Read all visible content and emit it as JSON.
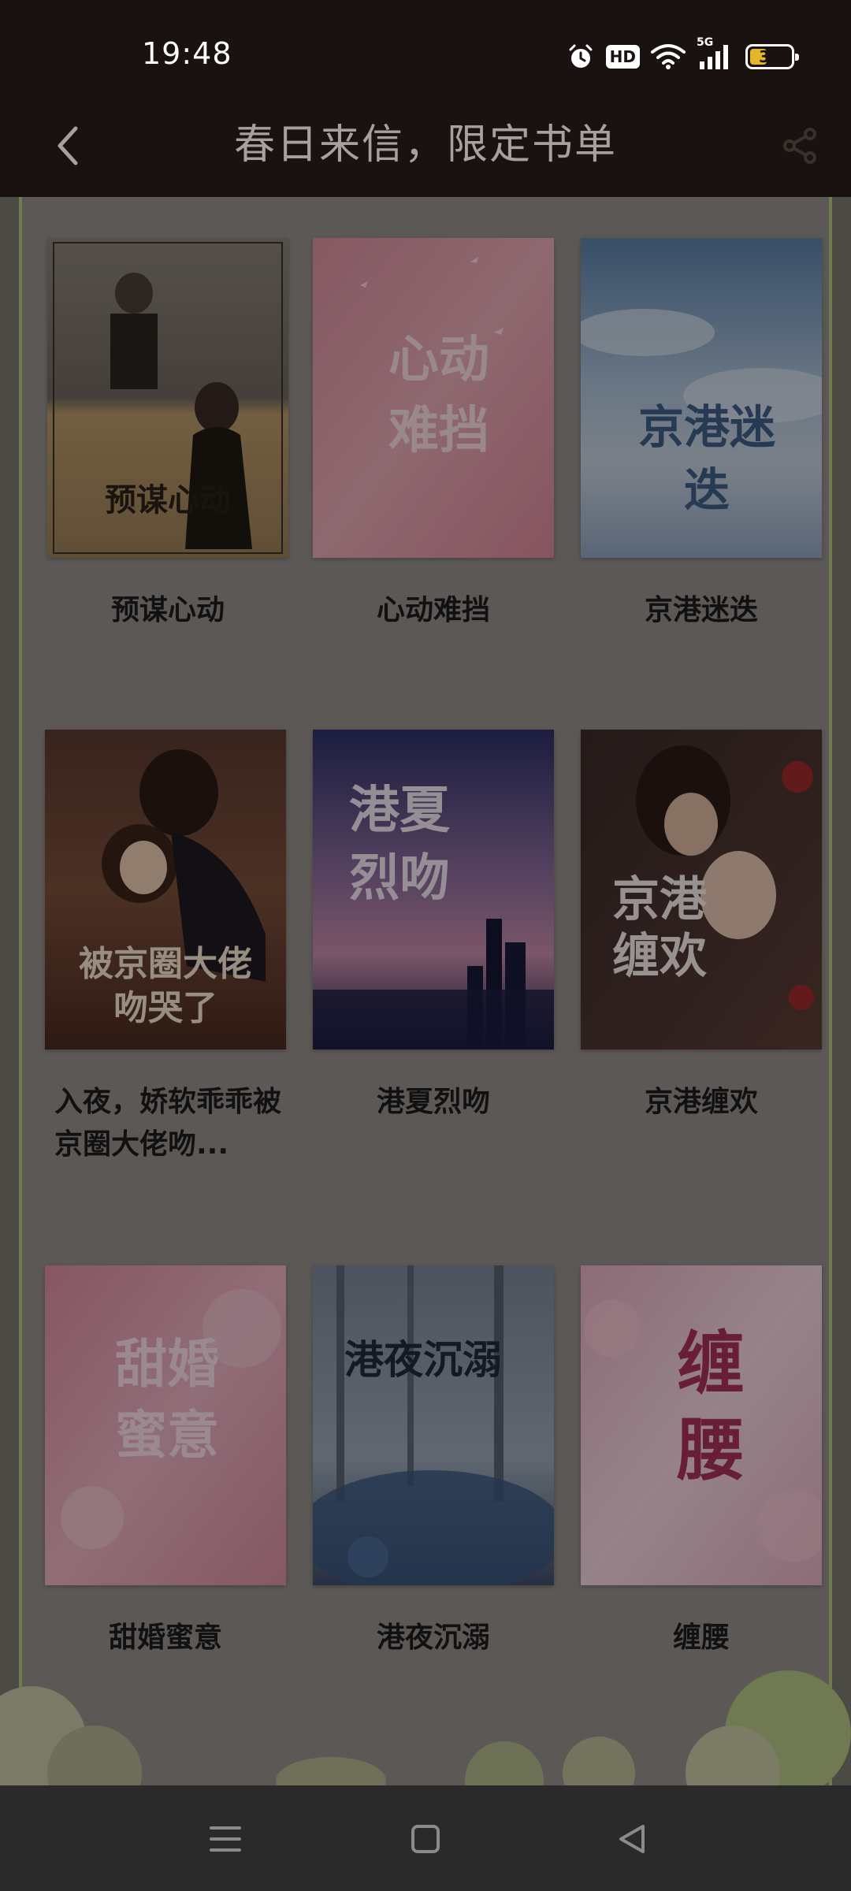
{
  "status_bar": {
    "time": "19:48",
    "icons": [
      "alarm-icon",
      "hd-icon",
      "wifi-icon",
      "5g-signal-icon",
      "battery-icon"
    ],
    "hd_label": "HD",
    "network_label": "5G",
    "battery_level": "39"
  },
  "header": {
    "title": "春日来信，限定书单",
    "back_icon": "chevron-left-icon",
    "share_icon": "share-icon"
  },
  "books": [
    {
      "title": "预谋心动",
      "cover_text": "预谋心动",
      "cover_colors": [
        "#8a8178",
        "#c9b28a"
      ],
      "cover_text_color": "#2a2016"
    },
    {
      "title": "心动难挡",
      "cover_text": "心动难挡",
      "cover_colors": [
        "#e9a7b4",
        "#d98b9a"
      ],
      "cover_text_color": "#f6dde2"
    },
    {
      "title": "京港迷迭",
      "cover_text": "京港迷迭",
      "cover_colors": [
        "#6d8fb2",
        "#b9c7d8"
      ],
      "cover_text_color": "#3e5d86"
    },
    {
      "title": "入夜，娇软乖乖被京圈大佬吻...",
      "cover_text": "被京圈大佬吻哭了",
      "cover_colors": [
        "#4b2a20",
        "#8a5a44"
      ],
      "cover_text_color": "#f3e3d0"
    },
    {
      "title": "港夏烈吻",
      "cover_text": "港夏烈吻",
      "cover_colors": [
        "#2c2f5c",
        "#7f5a86"
      ],
      "cover_text_color": "#f0e6f0"
    },
    {
      "title": "京港缠欢",
      "cover_text": "京港缠欢",
      "cover_colors": [
        "#3a2a28",
        "#6a4a44"
      ],
      "cover_text_color": "#f4ece6"
    },
    {
      "title": "甜婚蜜意",
      "cover_text": "甜婚蜜意",
      "cover_colors": [
        "#d88aa0",
        "#e9b3c2"
      ],
      "cover_text_color": "#f8dde6"
    },
    {
      "title": "港夜沉溺",
      "cover_text": "港夜沉溺",
      "cover_colors": [
        "#4d5a6e",
        "#8a97a8"
      ],
      "cover_text_color": "#1e2a3e"
    },
    {
      "title": "缠腰",
      "cover_text": "缠腰",
      "cover_colors": [
        "#e6b9c6",
        "#f1d3dc"
      ],
      "cover_text_color": "#a8305a"
    }
  ],
  "nav_bar": {
    "icons": [
      "menu-icon",
      "home-icon",
      "back-triangle-icon"
    ]
  }
}
